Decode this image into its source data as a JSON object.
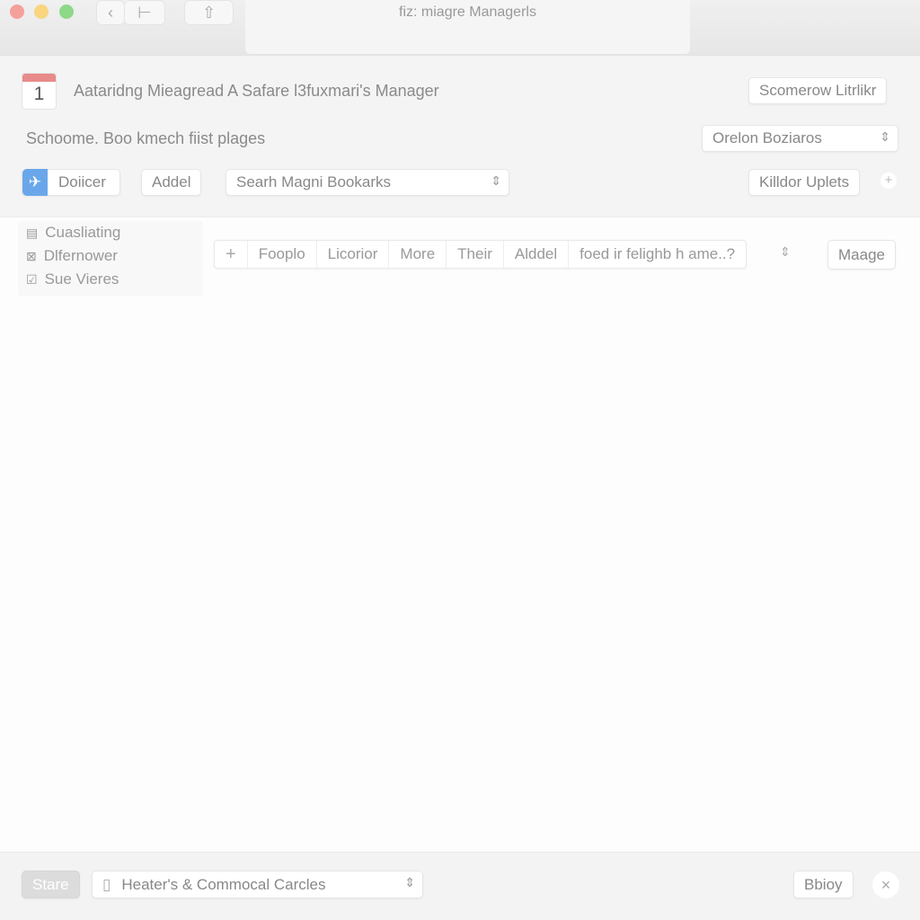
{
  "window": {
    "title": "fiz: miagre Managerls",
    "back_icon": "‹",
    "sidebar_icon": "⊢",
    "share_icon": "⇧"
  },
  "header": {
    "calendar_day": "1",
    "title": "Aataridng Mieagread A Safare l3fuxmari's Manager",
    "top_right_button": "Scomerow Litrlikr",
    "subtitle": "Schoome. Boo kmech fiist plages",
    "select_value": "Orelon Boziaros"
  },
  "controls": {
    "primary_button": "Doiicer",
    "add_button": "Addel",
    "search_select": "Searh Magni Bookarks",
    "right_button": "Killdor Uplets",
    "plus": "+"
  },
  "sidebar": {
    "items": [
      {
        "icon": "▤",
        "label": "Cuasliating"
      },
      {
        "icon": "⊠",
        "label": "Dlfernower"
      },
      {
        "icon": "☑",
        "label": "Sue Vieres"
      }
    ]
  },
  "tabs": {
    "add": "+",
    "items": [
      "Fooplo",
      "Licorior",
      "More",
      "Their",
      "Alddel",
      "foed ir felighb h ame..?"
    ],
    "manage": "Maage"
  },
  "footer": {
    "store_button": "Stare",
    "select_value": "Heater's & Commocal Carcles",
    "right_button": "Bbioy",
    "close": "×"
  },
  "colors": {
    "accent": "#6aa7ea",
    "close_light": "#f26b66",
    "min_light": "#f5c04b",
    "max_light": "#5fcb5a"
  }
}
